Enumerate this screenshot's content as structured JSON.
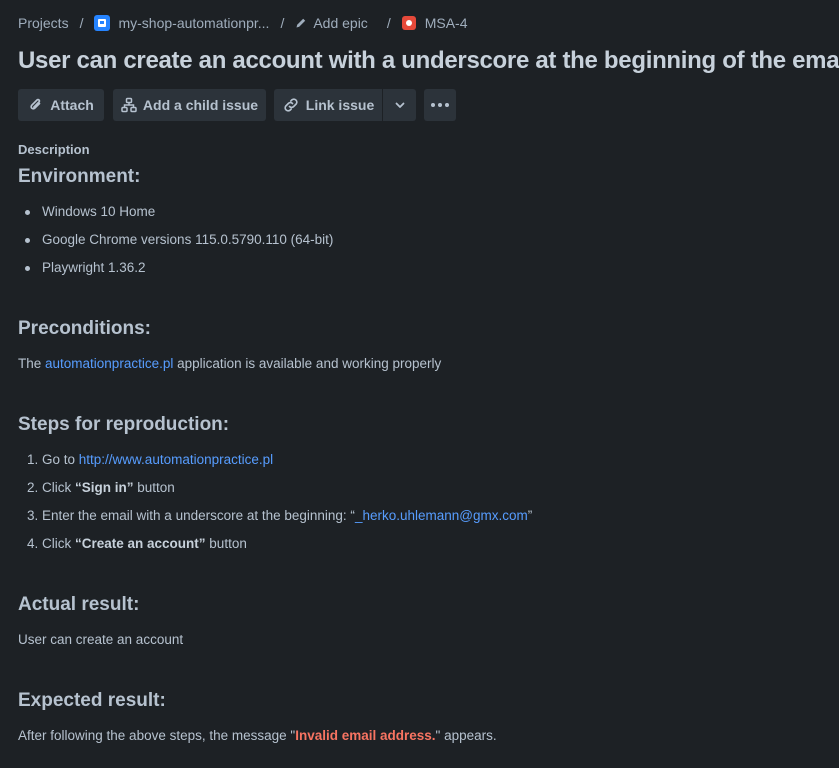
{
  "breadcrumb": {
    "projects": "Projects",
    "project": "my-shop-automationpr...",
    "epic": "Add epic",
    "issue_key": "MSA-4",
    "separator": "/"
  },
  "title": "User can create an account with a underscore at the beginning of the email",
  "toolbar": {
    "attach": "Attach",
    "add_child": "Add a child issue",
    "link_issue": "Link issue"
  },
  "description": {
    "label": "Description",
    "environment": {
      "heading": "Environment:",
      "items": [
        "Windows 10 Home",
        "Google Chrome versions 115.0.5790.110 (64-bit)",
        "Playwright 1.36.2"
      ]
    },
    "preconditions": {
      "heading": "Preconditions:",
      "prefix": "The ",
      "link": "automationpractice.pl",
      "suffix": " application is available and working properly"
    },
    "steps": {
      "heading": "Steps for reproduction:",
      "items": [
        {
          "num": "1.",
          "prefix": "Go to ",
          "link": "http://www.automationpractice.pl",
          "strong": "",
          "suffix": ""
        },
        {
          "num": "2.",
          "prefix": "Click ",
          "link": "",
          "strong": "“Sign in”",
          "suffix": " button"
        },
        {
          "num": "3.",
          "prefix": "Enter the email with a underscore at the beginning: “",
          "link": "_herko.uhlemann@gmx.com",
          "strong": "",
          "suffix": "”"
        },
        {
          "num": "4.",
          "prefix": "Click ",
          "link": "",
          "strong": "“Create an account”",
          "suffix": " button"
        }
      ]
    },
    "actual": {
      "heading": "Actual result:",
      "text": "User can create an account"
    },
    "expected": {
      "heading": "Expected result:",
      "prefix": "After following the above steps, the message \"",
      "error": "Invalid email address.",
      "suffix": "\" appears."
    }
  },
  "colors": {
    "background": "#1d2125",
    "text": "#b6c2cf",
    "link": "#579dff",
    "error": "#f87462",
    "button_bg": "#2c333a",
    "project_icon": "#2684ff",
    "bug_icon": "#e5493a"
  },
  "icons": {
    "project": "project-avatar-icon",
    "epic": "pencil-icon",
    "issue_type": "bug-icon",
    "attach": "paperclip-icon",
    "add_child": "hierarchy-icon",
    "link_issue": "link-icon",
    "dropdown": "chevron-down-icon",
    "more": "more-horizontal-icon"
  }
}
